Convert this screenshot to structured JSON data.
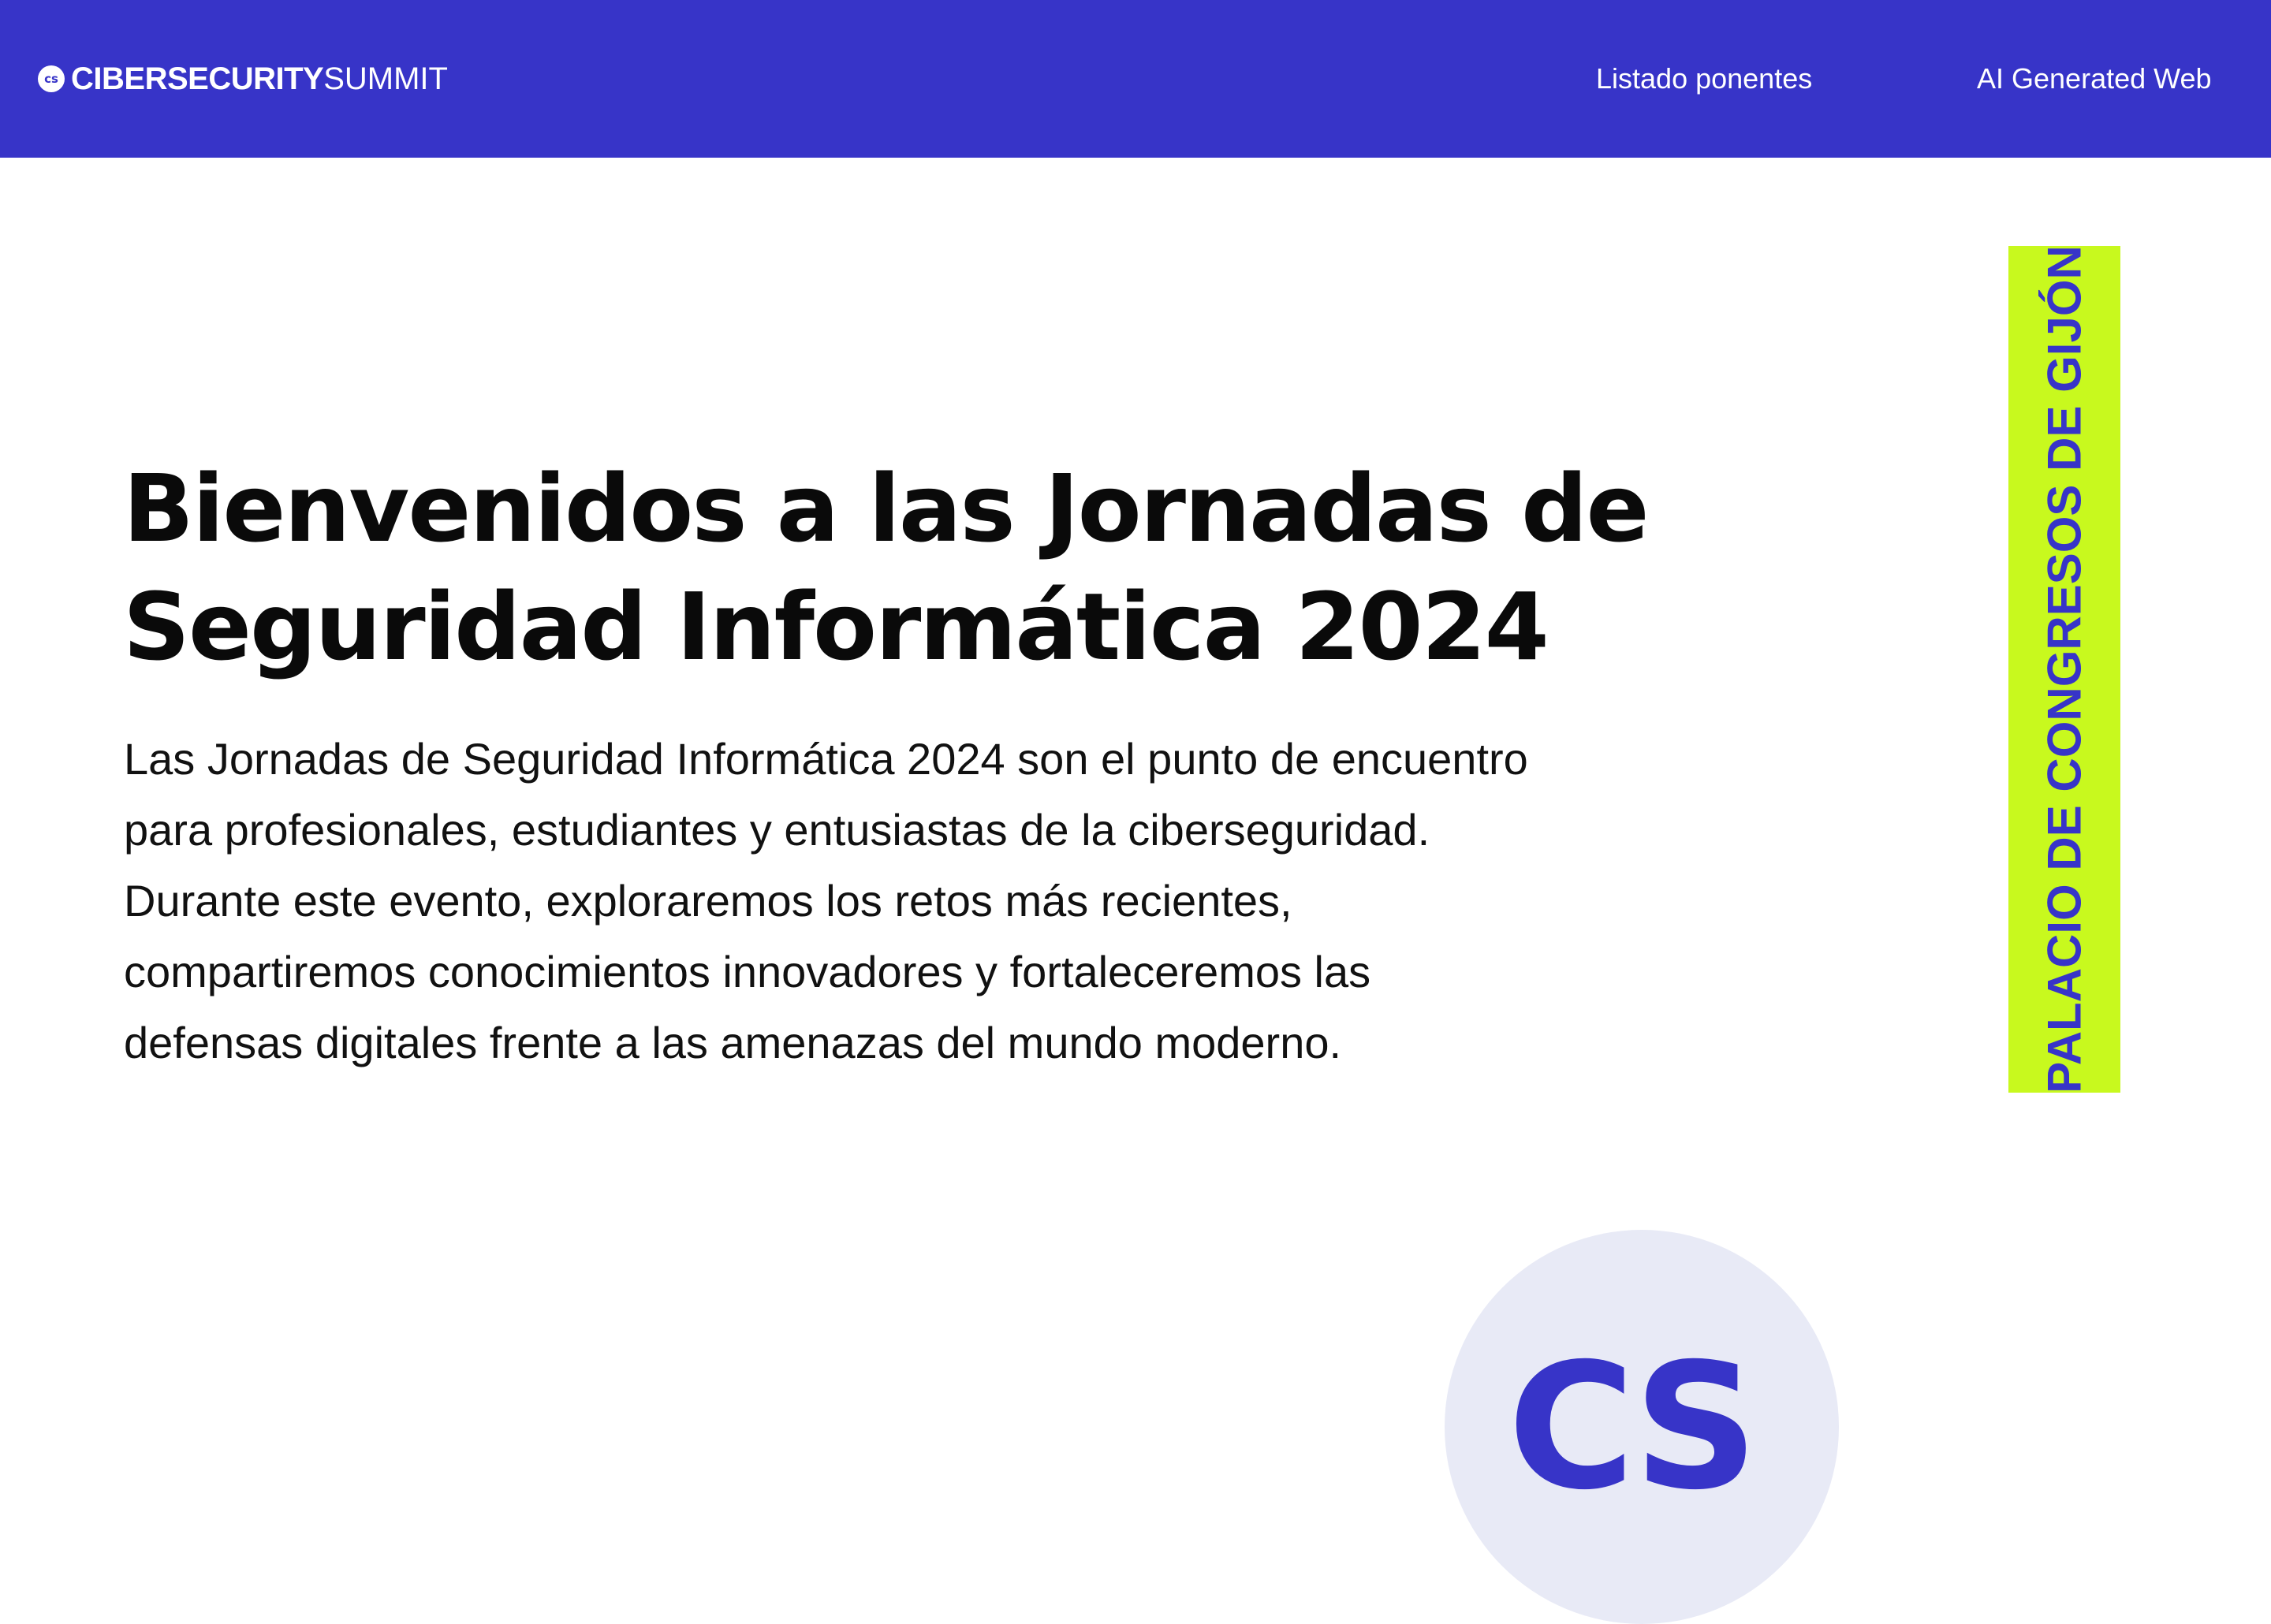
{
  "header": {
    "brand_icon_text": "cs",
    "brand_strong": "CIBERSECURITY",
    "brand_light": "SUMMIT",
    "nav": {
      "speakers": "Listado ponentes",
      "ai_web": "AI Generated Web"
    }
  },
  "hero": {
    "title_lines": [
      "Bienvenidos a las Jornadas de",
      "Seguridad Informática 2024"
    ],
    "description_lines": [
      "Las Jornadas de Seguridad Informática 2024 son el punto de encuentro",
      "para profesionales, estudiantes y entusiastas de la ciberseguridad.",
      "Durante este evento, exploraremos los retos más recientes,",
      "compartiremos conocimientos innovadores y fortaleceremos las",
      "defensas digitales frente a las amenazas del mundo moderno."
    ]
  },
  "venue_badge": {
    "text": "PALACIO DE CONGRESOS DE GIJÓN"
  },
  "logo": {
    "letters": "CS"
  },
  "colors": {
    "brand": "#3734c8",
    "accent": "#c8f91e",
    "logo_bg": "#e8eaf6",
    "text": "#0a0a0a"
  }
}
